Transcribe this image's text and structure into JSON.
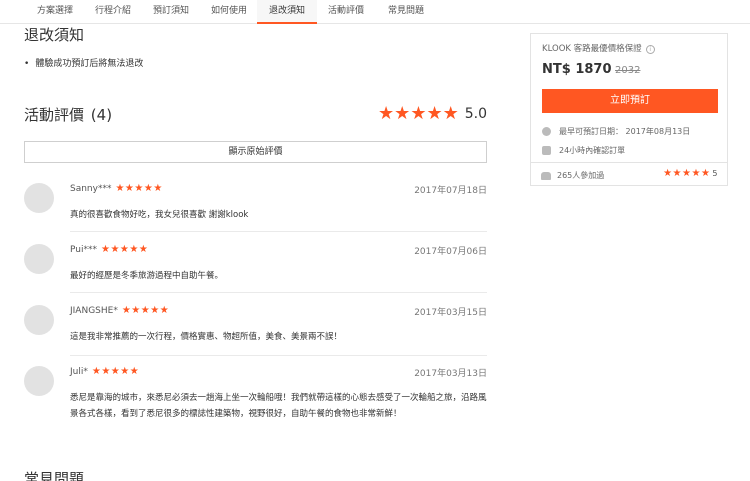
{
  "nav": {
    "tabs": [
      {
        "label": "方案選擇"
      },
      {
        "label": "行程介紹"
      },
      {
        "label": "預訂須知"
      },
      {
        "label": "如何使用"
      },
      {
        "label": "退改須知"
      },
      {
        "label": "活動評價"
      },
      {
        "label": "常見問題"
      }
    ],
    "active_index": 4
  },
  "refund": {
    "title": "退改須知",
    "items": [
      "體驗成功預訂后將無法退改"
    ]
  },
  "reviews_section": {
    "title": "活動評價",
    "count": "(4)",
    "stars": "★★★★★",
    "score": "5.0",
    "show_original_label": "顯示原始評價"
  },
  "reviews": [
    {
      "user": "Sanny***",
      "stars": "★★★★★",
      "date": "2017年07月18日",
      "text": "真的很喜歡食物好吃，我女兒很喜歡 謝謝klook"
    },
    {
      "user": "Pui***",
      "stars": "★★★★★",
      "date": "2017年07月06日",
      "text": "最好的經歷是冬季旅游過程中自助午餐。"
    },
    {
      "user": "JIANGSHE*",
      "stars": "★★★★★",
      "date": "2017年03月15日",
      "text": "這是我非常推薦的一次行程，價格實惠、物超所值，美食、美景兩不誤！"
    },
    {
      "user": "Juli*",
      "stars": "★★★★★",
      "date": "2017年03月13日",
      "text": "悉尼是靠海的城市，來悉尼必須去一趟海上坐一次輪船哦！我們就帶這樣的心態去感受了一次輪船之旅，沿路風景各式各樣，看到了悉尼很多的標誌性建築物，視野很好，自助午餐的食物也非常新鮮！"
    }
  ],
  "faq": {
    "title": "常見問題"
  },
  "booking": {
    "guarantee_label": "KLOOK 客路最優價格保證",
    "info_icon": "ⓘ",
    "price": "NT$ 1870",
    "old_price": "2032",
    "book_button": "立即預訂",
    "earliest_date": "最早可預訂日期： 2017年08月13日",
    "confirm": "24小時內確認訂單",
    "participants": "265人參加過",
    "stars": "★★★★★",
    "rating": "5",
    "accent_color": "#ff5722"
  }
}
